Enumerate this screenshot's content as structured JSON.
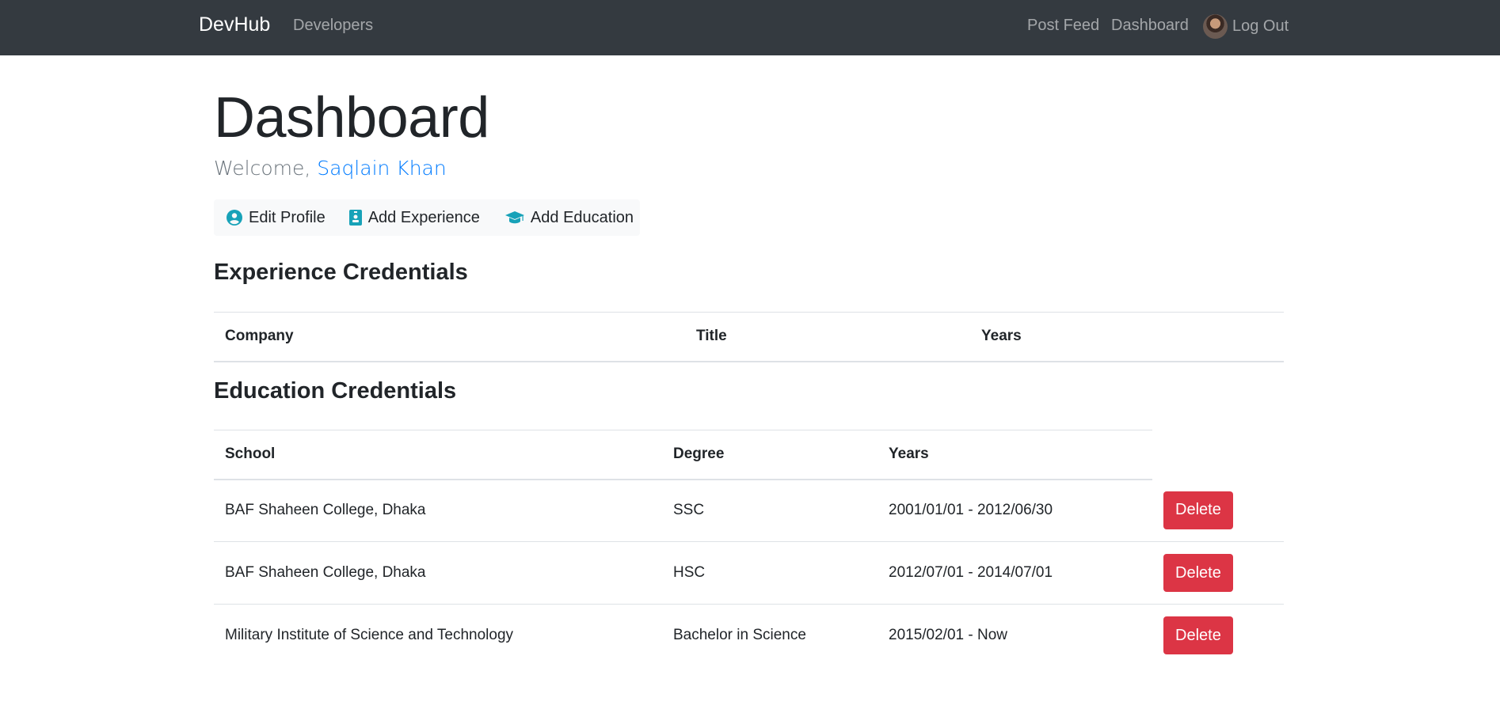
{
  "nav": {
    "brand": "DevHub",
    "developers": "Developers",
    "post_feed": "Post Feed",
    "dashboard": "Dashboard",
    "logout": "Log Out"
  },
  "page": {
    "title": "Dashboard",
    "welcome_prefix": "Welcome, ",
    "user_name": "Saqlain Khan"
  },
  "actions": {
    "edit_profile": "Edit Profile",
    "add_experience": "Add Experience",
    "add_education": "Add Education"
  },
  "experience": {
    "heading": "Experience Credentials",
    "columns": [
      "Company",
      "Title",
      "Years"
    ]
  },
  "education": {
    "heading": "Education Credentials",
    "columns": [
      "School",
      "Degree",
      "Years"
    ],
    "rows": [
      {
        "school": "BAF Shaheen College, Dhaka",
        "degree": "SSC",
        "years": "2001/01/01 - 2012/06/30",
        "action": "Delete"
      },
      {
        "school": "BAF Shaheen College, Dhaka",
        "degree": "HSC",
        "years": "2012/07/01 - 2014/07/01",
        "action": "Delete"
      },
      {
        "school": "Military Institute of Science and Technology",
        "degree": "Bachelor in Science",
        "years": "2015/02/01 - Now",
        "action": "Delete"
      }
    ]
  },
  "colors": {
    "navbar": "#343a40",
    "link": "#007bff",
    "icon": "#17a2b8",
    "danger": "#dc3545"
  },
  "icons": {
    "edit_profile": "user-circle-icon",
    "add_experience": "id-badge-icon",
    "add_education": "graduation-cap-icon"
  }
}
